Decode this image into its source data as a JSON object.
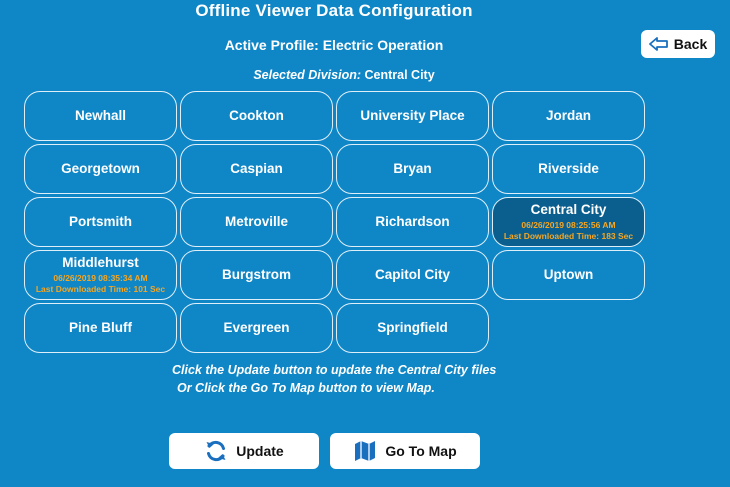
{
  "header": {
    "title": "Offline Viewer Data Configuration",
    "profile": "Active Profile: Electric Operation",
    "division_label": "Selected Division:",
    "division_value": "Central City"
  },
  "back": {
    "label": "Back",
    "icon": "back-arrow-icon"
  },
  "cities": [
    {
      "name": "Newhall",
      "date": "",
      "last": ""
    },
    {
      "name": "Cookton",
      "date": "",
      "last": ""
    },
    {
      "name": "University Place",
      "date": "",
      "last": ""
    },
    {
      "name": "Jordan",
      "date": "",
      "last": ""
    },
    {
      "name": "Georgetown",
      "date": "",
      "last": ""
    },
    {
      "name": "Caspian",
      "date": "",
      "last": ""
    },
    {
      "name": "Bryan",
      "date": "",
      "last": ""
    },
    {
      "name": "Riverside",
      "date": "",
      "last": ""
    },
    {
      "name": "Portsmith",
      "date": "",
      "last": ""
    },
    {
      "name": "Metroville",
      "date": "",
      "last": ""
    },
    {
      "name": "Richardson",
      "date": "",
      "last": ""
    },
    {
      "name": "Central City",
      "date": "06/26/2019 08:25:56 AM",
      "last": "Last Downloaded Time: 183 Sec",
      "selected": true
    },
    {
      "name": "Middlehurst",
      "date": "06/26/2019 08:35:34 AM",
      "last": "Last Downloaded Time: 101 Sec"
    },
    {
      "name": "Burgstrom",
      "date": "",
      "last": ""
    },
    {
      "name": "Capitol City",
      "date": "",
      "last": ""
    },
    {
      "name": "Uptown",
      "date": "",
      "last": ""
    },
    {
      "name": "Pine Bluff",
      "date": "",
      "last": ""
    },
    {
      "name": "Evergreen",
      "date": "",
      "last": ""
    },
    {
      "name": "Springfield",
      "date": "",
      "last": ""
    }
  ],
  "instructions": {
    "line1": "Click the Update button to update the Central City files",
    "line2": "Or Click the Go To Map button to view Map."
  },
  "buttons": {
    "update_label": "Update",
    "update_icon": "refresh-icon",
    "map_label": "Go To Map",
    "map_icon": "map-icon"
  },
  "colors": {
    "background": "#0f86c6",
    "selected_tile": "#0b5f8e",
    "download_info": "#f5a623",
    "icon_blue": "#1a6fbf"
  }
}
